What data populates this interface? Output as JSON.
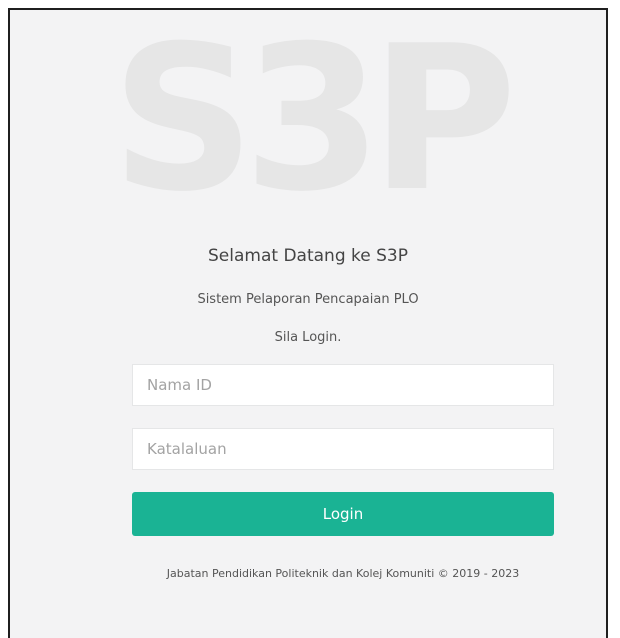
{
  "brand": {
    "logo_text": "S3P"
  },
  "header": {
    "welcome": "Selamat Datang ke S3P",
    "subtitle": "Sistem Pelaporan Pencapaian PLO",
    "prompt": "Sila Login."
  },
  "form": {
    "username_placeholder": "Nama ID",
    "username_value": "",
    "password_placeholder": "Katalaluan",
    "password_value": "",
    "login_label": "Login"
  },
  "footer": {
    "text": "Jabatan Pendidikan Politeknik dan Kolej Komuniti © 2019 - 2023"
  },
  "colors": {
    "accent": "#1ab394",
    "background": "#f3f3f4",
    "logo_watermark": "#e6e6e6"
  }
}
